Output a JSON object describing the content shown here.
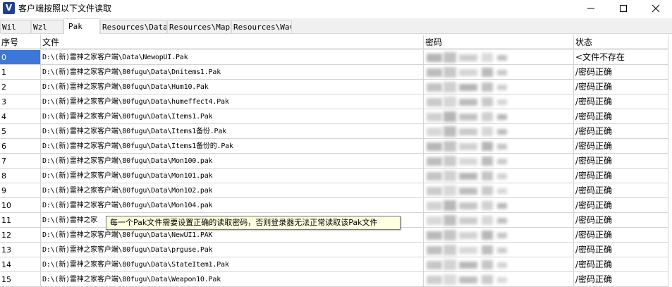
{
  "window": {
    "icon_glyph": "V",
    "title": "客户端按照以下文件读取",
    "controls": [
      "minimize-icon",
      "maximize-icon",
      "close-icon"
    ]
  },
  "tabs": [
    {
      "label": "Wil",
      "active": false
    },
    {
      "label": "Wzl",
      "active": false
    },
    {
      "label": "Pak",
      "active": true
    },
    {
      "label": "Resources\\Data",
      "active": false
    },
    {
      "label": "Resources\\Map",
      "active": false
    },
    {
      "label": "Resources\\Wav",
      "active": false
    }
  ],
  "table": {
    "headers": {
      "index": "序号",
      "file": "文件",
      "password": "密码",
      "status": "状态"
    },
    "rows": [
      {
        "index": "0",
        "file": "D:\\(新)雷神之家客户端\\Data\\NewopUI.Pak",
        "status": "<文件不存在"
      },
      {
        "index": "1",
        "file": "D:\\(新)雷神之家客户端\\80fugu\\Data\\Dnitems1.Pak",
        "status": "/密码正确"
      },
      {
        "index": "2",
        "file": "D:\\(新)雷神之家客户端\\80fugu\\Data\\Hum10.Pak",
        "status": "/密码正确"
      },
      {
        "index": "3",
        "file": "D:\\(新)雷神之家客户端\\80fugu\\Data\\humeffect4.Pak",
        "status": "/密码正确"
      },
      {
        "index": "4",
        "file": "D:\\(新)雷神之家客户端\\80fugu\\Data\\Items1.Pak",
        "status": "/密码正确"
      },
      {
        "index": "5",
        "file": "D:\\(新)雷神之家客户端\\80fugu\\Data\\Items1备份.Pak",
        "status": "/密码正确"
      },
      {
        "index": "6",
        "file": "D:\\(新)雷神之家客户端\\80fugu\\Data\\Items1备份的.Pak",
        "status": "/密码正确"
      },
      {
        "index": "7",
        "file": "D:\\(新)雷神之家客户端\\80fugu\\Data\\Mon100.pak",
        "status": "/密码正确"
      },
      {
        "index": "8",
        "file": "D:\\(新)雷神之家客户端\\80fugu\\Data\\Mon101.pak",
        "status": "/密码正确"
      },
      {
        "index": "9",
        "file": "D:\\(新)雷神之家客户端\\80fugu\\Data\\Mon102.pak",
        "status": "/密码正确"
      },
      {
        "index": "10",
        "file": "D:\\(新)雷神之家客户端\\80fugu\\Data\\Mon104.pak",
        "status": "/密码正确"
      },
      {
        "index": "11",
        "file": "D:\\(新)雷神之家",
        "status": "/密码正确"
      },
      {
        "index": "12",
        "file": "D:\\(新)雷神之家客户端\\80fugu\\Data\\NewUI1.PAK",
        "status": "/密码正确"
      },
      {
        "index": "13",
        "file": "D:\\(新)雷神之家客户端\\80fugu\\Data\\prguse.Pak",
        "status": "/密码正确"
      },
      {
        "index": "14",
        "file": "D:\\(新)雷神之家客户端\\80fugu\\Data\\StateItem1.Pak",
        "status": "/密码正确"
      },
      {
        "index": "15",
        "file": "D:\\(新)雷神之家客户端\\80fugu\\Data\\Weapon10.Pak",
        "status": "/密码正确"
      }
    ],
    "selected_index": 0
  },
  "tooltip": {
    "text": "每一个Pak文件需要设置正确的读取密码，否则登录器无法正常读取该Pak文件"
  },
  "colors": {
    "selection": "#3d78d8",
    "tooltip_bg": "#ffffe1",
    "app_icon": "#1f3f8f"
  }
}
